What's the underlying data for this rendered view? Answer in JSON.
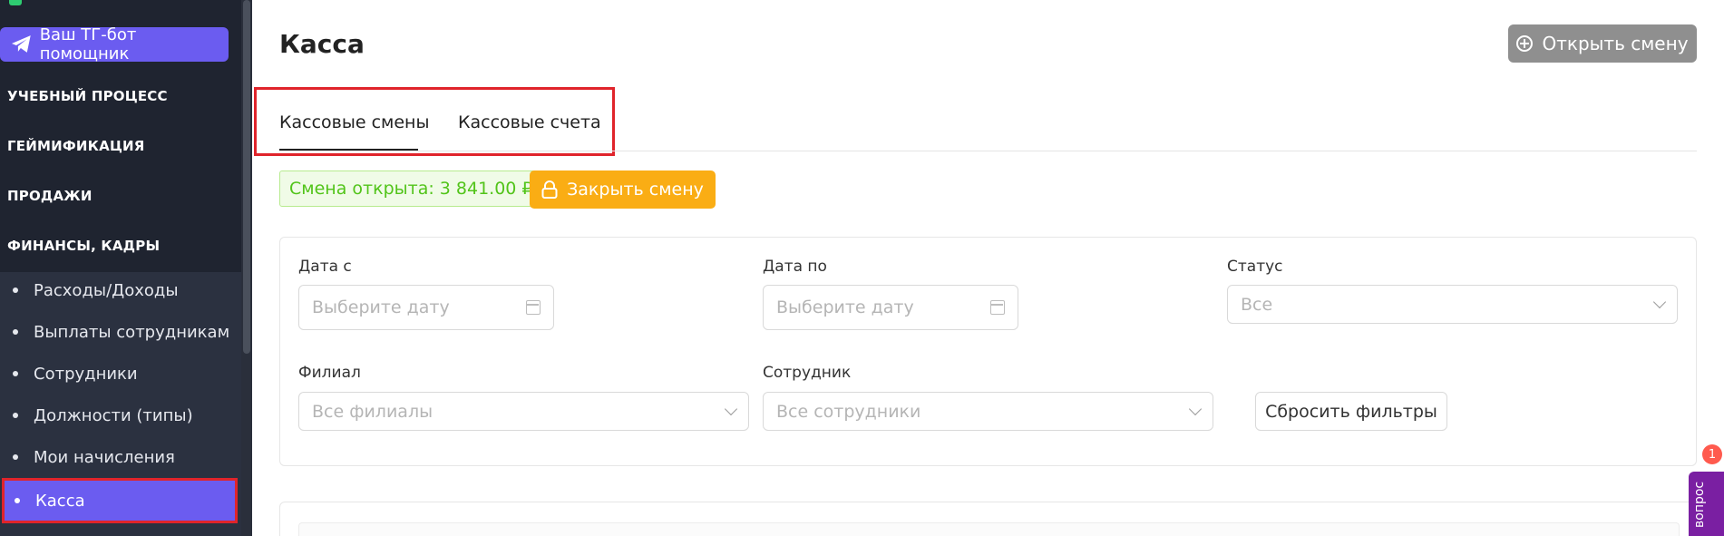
{
  "sidebar": {
    "tg_button": "Ваш ТГ-бот помощник",
    "sections": [
      "УЧЕБНЫЙ ПРОЦЕСС",
      "ГЕЙМИФИКАЦИЯ",
      "ПРОДАЖИ",
      "ФИНАНСЫ, КАДРЫ"
    ],
    "submenu": [
      {
        "label": "Расходы/Доходы"
      },
      {
        "label": "Выплаты сотрудникам"
      },
      {
        "label": "Сотрудники"
      },
      {
        "label": "Должности (типы)"
      },
      {
        "label": "Мои начисления"
      },
      {
        "label": "Касса",
        "active": true
      }
    ]
  },
  "header": {
    "title": "Касса",
    "open_shift_label": "Открыть смену"
  },
  "tabs": [
    {
      "label": "Кассовые смены",
      "active": true
    },
    {
      "label": "Кассовые счета",
      "active": false
    }
  ],
  "shift": {
    "status_text": "Смена открыта: 3 841.00 ₽",
    "close_label": "Закрыть смену"
  },
  "filters": {
    "date_from": {
      "label": "Дата с",
      "placeholder": "Выберите дату"
    },
    "date_to": {
      "label": "Дата по",
      "placeholder": "Выберите дату"
    },
    "status": {
      "label": "Статус",
      "value": "Все"
    },
    "branch": {
      "label": "Филиал",
      "value": "Все филиалы"
    },
    "employee": {
      "label": "Сотрудник",
      "value": "Все сотрудники"
    },
    "reset_label": "Сбросить фильтры"
  },
  "chat": {
    "label": "вопрос",
    "badge": "1"
  },
  "colors": {
    "sidebar_bg": "#1f2430",
    "accent": "#6b5cf0",
    "highlight_border": "#e0242b",
    "warning": "#faad14",
    "success": "#52c41a"
  }
}
